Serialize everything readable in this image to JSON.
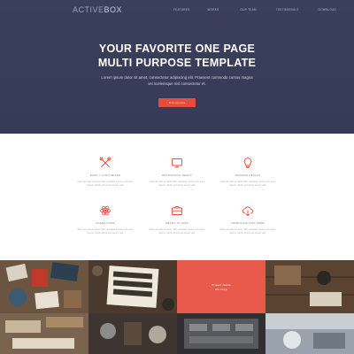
{
  "brand": {
    "logo_light": "ACTIVE",
    "logo_bold": "BOX"
  },
  "nav": {
    "items": [
      "Features",
      "Works",
      "Our Team",
      "Testimonials",
      "Download"
    ]
  },
  "hero": {
    "headline_line1": "YOUR FAVORITE ONE PAGE",
    "headline_line2": "MULTI PURPOSE TEMPLATE",
    "sub_line1": "Lorem ipsum dolor sit amet, consectetur adipiscing elit. Praesent commodo cursus magna",
    "sub_line2": "vel scelerisque nisl consectetur et.",
    "cta_label": "Find out more",
    "background_color": "#3a3f5c",
    "accent_color": "#e74c3c"
  },
  "features": [
    {
      "icon": "tools-icon",
      "title": "Easily Customised",
      "desc": "Duis sed odio sit amet nibh vulputate cursus a sit amet mauris. Morbi accumsan ipsum velit."
    },
    {
      "icon": "monitor-icon",
      "title": "Responsive Ready",
      "desc": "Duis sed odio sit amet nibh vulputate cursus a sit amet mauris. Morbi accumsan ipsum velit."
    },
    {
      "icon": "lightbulb-icon",
      "title": "Modern Design",
      "desc": "Duis sed odio sit amet nibh vulputate cursus a sit amet mauris. Morbi accumsan ipsum velit."
    },
    {
      "icon": "atom-icon",
      "title": "Clean Code",
      "desc": "Duis sed odio sit amet nibh vulputate cursus a sit amet mauris. Morbi accumsan ipsum velit."
    },
    {
      "icon": "briefcase-icon",
      "title": "Ready to Ship",
      "desc": "Duis sed odio sit amet nibh vulputate cursus a sit amet mauris. Morbi accumsan ipsum velit."
    },
    {
      "icon": "cloud-download-icon",
      "title": "Download for Free",
      "desc": "Duis sed odio sit amet nibh vulputate cursus a sit amet mauris. Morbi accumsan ipsum velit."
    }
  ],
  "gallery": {
    "highlight_title": "Project Name",
    "highlight_sub": "Web Design"
  }
}
